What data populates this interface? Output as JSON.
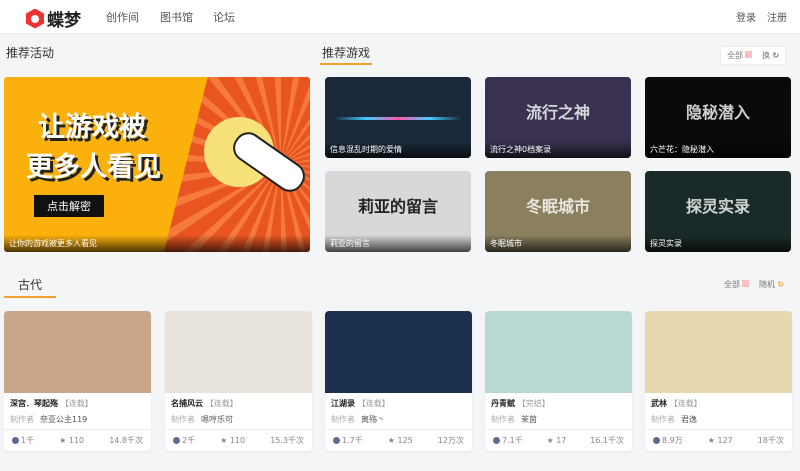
{
  "header": {
    "brand": "蝶梦",
    "nav": [
      "创作间",
      "图书馆",
      "论坛"
    ],
    "login": "登录",
    "register": "注册"
  },
  "activities": {
    "title": "推荐活动",
    "banner": {
      "line1": "让游戏被",
      "line2": "更多人看见",
      "button": "点击解密",
      "caption": "让你的游戏被更多人看见"
    }
  },
  "games": {
    "title": "推荐游戏",
    "all": "全部",
    "refresh": "换",
    "items": [
      {
        "caption": "信息混乱时期的爱情",
        "color": "#1a2a3a"
      },
      {
        "caption": "流行之神0档案录",
        "color": "#3a3050",
        "art": "流行之神"
      },
      {
        "caption": "六芒花：隐秘潜入",
        "color": "#0a0a0a",
        "art": "隐秘潜入"
      },
      {
        "caption": "莉亚的留言",
        "color": "#d8d8d8",
        "art": "莉亚的留言"
      },
      {
        "caption": "冬眠城市",
        "color": "#8a8060",
        "art": "冬眠城市"
      },
      {
        "caption": "探灵实录",
        "color": "#1a2a28",
        "art": "探灵实录"
      }
    ]
  },
  "category": {
    "tab": "古代",
    "all": "全部",
    "random": "随机",
    "author_label": "制作者",
    "items": [
      {
        "title": "深宫．琴起殇",
        "status": "【连载】",
        "author": "奈亚公主119",
        "likes": "1千",
        "stars": "110",
        "views": "14.8千次",
        "color": "#c9a58a"
      },
      {
        "title": "名捕风云",
        "status": "【连载】",
        "author": "嗯哼乐可",
        "likes": "2千",
        "stars": "110",
        "views": "15.3千次",
        "color": "#e8e4dc"
      },
      {
        "title": "江湖录",
        "status": "【连载】",
        "author": "离殇丶",
        "likes": "1.7千",
        "stars": "125",
        "views": "12万次",
        "color": "#1c3050"
      },
      {
        "title": "丹青赋",
        "status": "【完结】",
        "author": "茉茵",
        "likes": "7.1千",
        "stars": "17",
        "views": "16.1千次",
        "color": "#b8d8d4"
      },
      {
        "title": "武林",
        "status": "【连载】",
        "author": "君逸",
        "likes": "8.9万",
        "stars": "127",
        "views": "18千次",
        "color": "#e8d8b0"
      }
    ]
  }
}
